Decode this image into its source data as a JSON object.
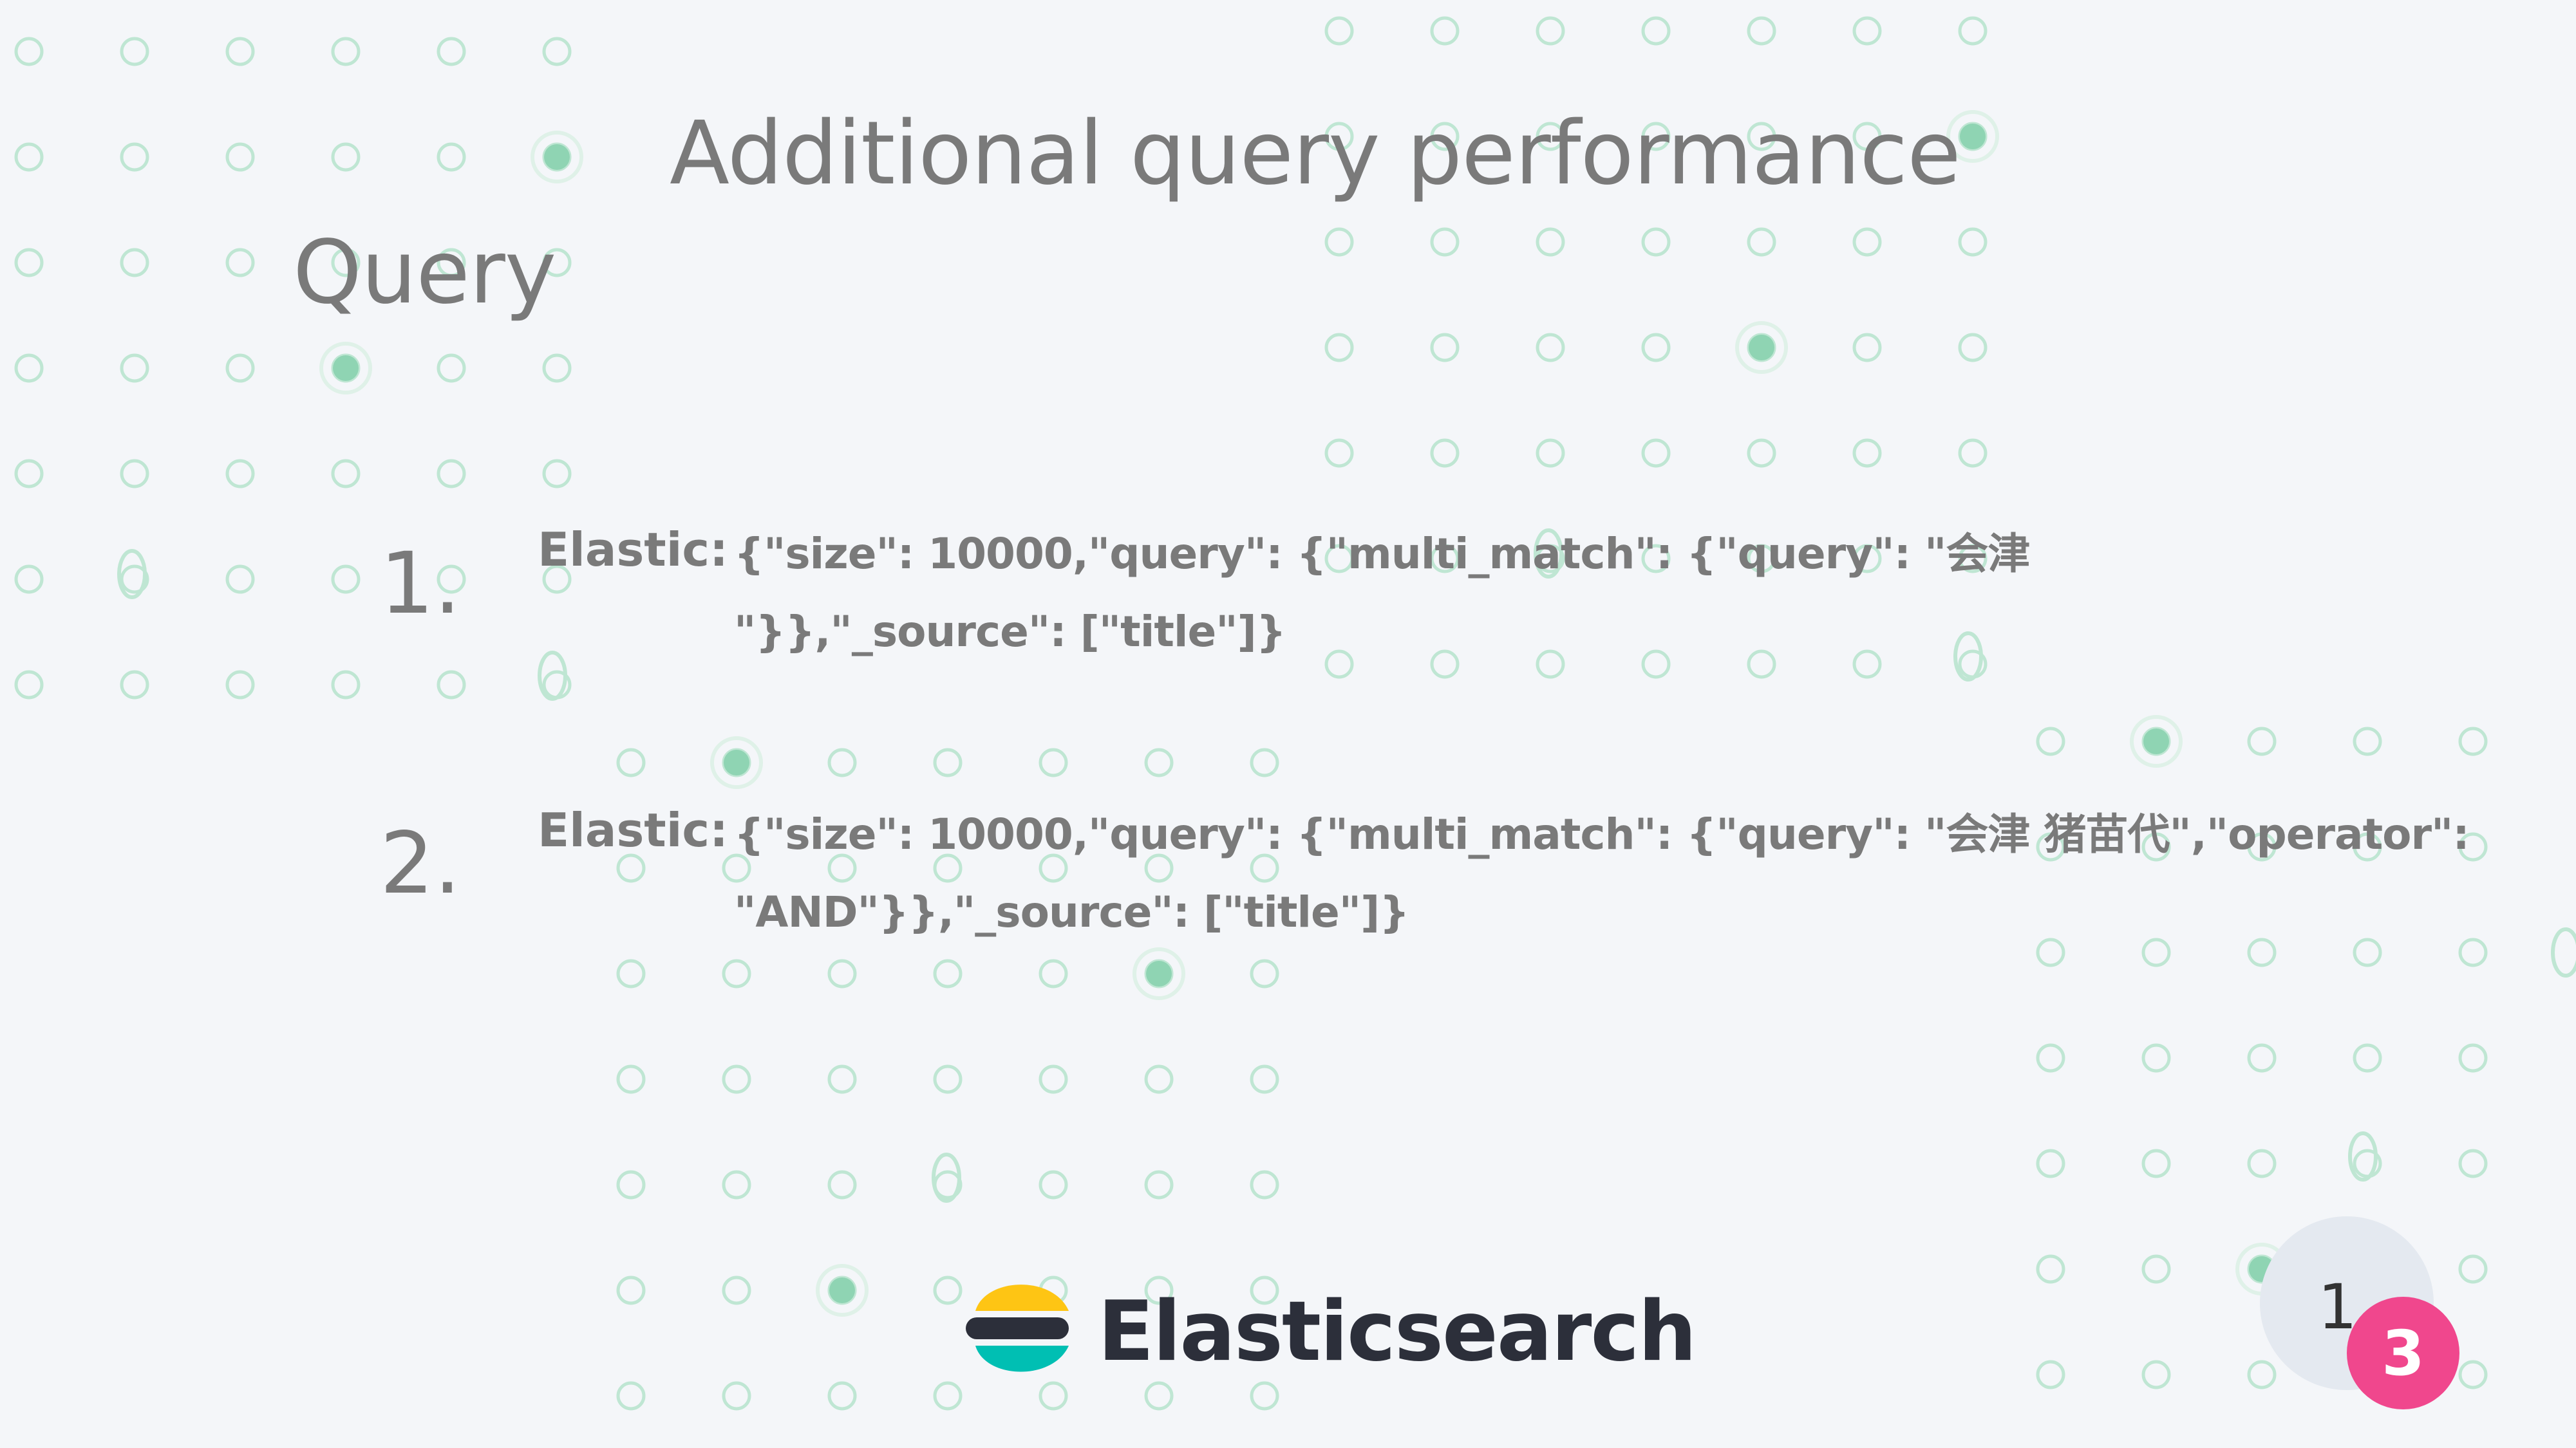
{
  "slide": {
    "title_line1": "Additional query performance",
    "title_line2": "Query"
  },
  "items": [
    {
      "number": "1.",
      "label": "Elastic:",
      "code_line1": "{\"size\": 10000,\"query\": {\"multi_match\": {\"query\": \"会津",
      "code_line2": "\"}},\"_source\": [\"title\"]}"
    },
    {
      "number": "2.",
      "label": "Elastic:",
      "code_line1": "{\"size\": 10000,\"query\": {\"multi_match\": {\"query\": \"会津 猪苗代\",\"operator\":",
      "code_line2": "\"AND\"}},\"_source\": [\"title\"]}"
    }
  ],
  "footer": {
    "brand": "Elasticsearch",
    "logo_icon": "elasticsearch-logo-icon",
    "page_digit_1": "1",
    "page_digit_2": "3"
  },
  "colors": {
    "background": "#f4f6f9",
    "text_grey": "#7a7a7a",
    "dot_outline": "#bfe6d3",
    "dot_fill": "#8fd4b3",
    "brand_dark": "#2c2f3a",
    "logo_yellow": "#fec514",
    "logo_teal": "#00bfb3",
    "page_badge_pink": "#f0478d",
    "page_circle_grey": "#e4e9f0"
  }
}
